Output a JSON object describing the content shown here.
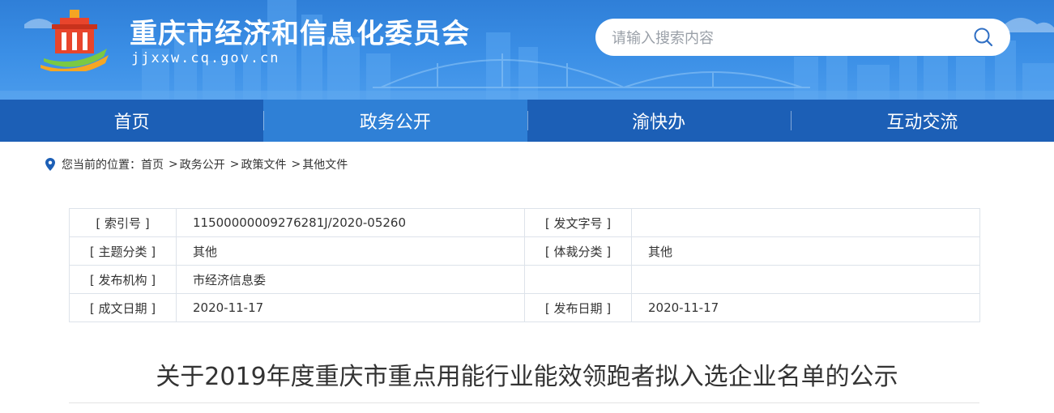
{
  "header": {
    "site_title": "重庆市经济和信息化委员会",
    "site_domain": "jjxxw.cq.gov.cn",
    "search_placeholder": "请输入搜索内容",
    "search_icon": "search-icon",
    "colors": {
      "banner": "#3b8fe6",
      "nav": "#1c5fb6",
      "nav_active": "#2f80d6"
    }
  },
  "nav": {
    "items": [
      {
        "label": "首页"
      },
      {
        "label": "政务公开",
        "active": true
      },
      {
        "label": "渝快办"
      },
      {
        "label": "互动交流"
      }
    ]
  },
  "breadcrumb": {
    "prefix": "您当前的位置：",
    "items": [
      "首页",
      "政务公开",
      "政策文件",
      "其他文件"
    ],
    "separator": ">"
  },
  "info_table": {
    "rows": [
      {
        "k1": "[ 索引号 ]",
        "v1": "11500000009276281J/2020-05260",
        "k2": "[ 发文字号 ]",
        "v2": ""
      },
      {
        "k1": "[ 主题分类 ]",
        "v1": "其他",
        "k2": "[ 体裁分类 ]",
        "v2": "其他"
      },
      {
        "k1": "[ 发布机构 ]",
        "v1": "市经济信息委",
        "k2": "",
        "v2": ""
      },
      {
        "k1": "[ 成文日期 ]",
        "v1": "2020-11-17",
        "k2": "[ 发布日期 ]",
        "v2": "2020-11-17"
      }
    ]
  },
  "article": {
    "title": "关于2019年度重庆市重点用能行业能效领跑者拟入选企业名单的公示"
  }
}
